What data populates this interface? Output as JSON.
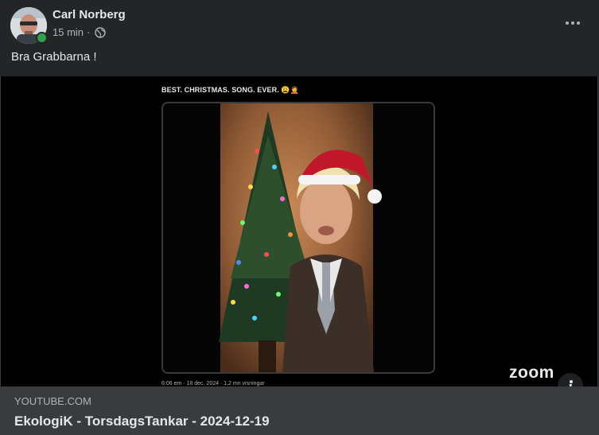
{
  "post": {
    "author": "Carl Norberg",
    "time": "15 min",
    "separator": "·",
    "text": "Bra Grabbarna !"
  },
  "media": {
    "tweet_line": "BEST. CHRISTMAS. SONG. EVER. 😩🤦",
    "tweet_footer": "6:06 em · 18 dec. 2024 · 1,2 mn visningar",
    "zoom_label": "zoom"
  },
  "link": {
    "domain": "YOUTUBE.COM",
    "title": "EkologiK - TorsdagsTankar - 2024-12-19"
  },
  "icons": {
    "globe": "globe-icon",
    "more": "more-options-icon",
    "info": "info-icon"
  },
  "colors": {
    "card_bg": "#242526",
    "link_bg": "#3a3b3c",
    "online": "#31a24c"
  }
}
